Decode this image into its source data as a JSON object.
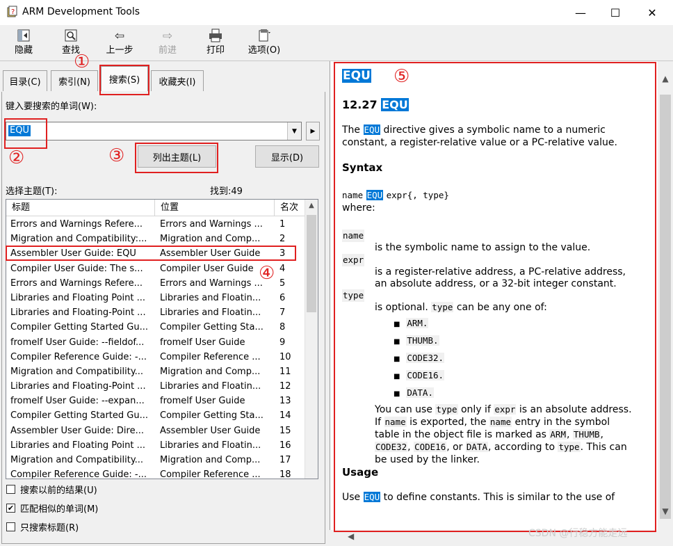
{
  "window": {
    "title": "ARM Development Tools",
    "minimize": "—",
    "maximize": "☐",
    "close": "✕"
  },
  "toolbar": {
    "hide": "隐藏",
    "find": "查找",
    "back": "上一步",
    "forward": "前进",
    "print": "打印",
    "options": "选项(O)"
  },
  "tabs": {
    "contents": "目录(C)",
    "index": "索引(N)",
    "search": "搜索(S)",
    "favorites": "收藏夹(I)"
  },
  "search": {
    "prompt": "键入要搜索的单词(W):",
    "value": "EQU",
    "list_topics": "列出主题(L)",
    "display": "显示(D)",
    "select_topic": "选择主题(T):",
    "found": "找到:49"
  },
  "table": {
    "headers": [
      "标题",
      "位置",
      "名次"
    ],
    "rows": [
      [
        "Errors and Warnings Refere...",
        "Errors and Warnings ...",
        "1"
      ],
      [
        "Migration and Compatibility:...",
        "Migration and Comp...",
        "2"
      ],
      [
        "Assembler User Guide: EQU",
        "Assembler User Guide",
        "3"
      ],
      [
        "Compiler User Guide: The s...",
        "Compiler User Guide",
        "4"
      ],
      [
        "Errors and Warnings Refere...",
        "Errors and Warnings ...",
        "5"
      ],
      [
        "Libraries and Floating Point ...",
        "Libraries and Floatin...",
        "6"
      ],
      [
        "Libraries and Floating-Point ...",
        "Libraries and Floatin...",
        "7"
      ],
      [
        "Compiler Getting Started Gu...",
        "Compiler Getting Sta...",
        "8"
      ],
      [
        "fromelf User Guide: --fieldof...",
        "fromelf User Guide",
        "9"
      ],
      [
        "Compiler Reference Guide: -...",
        "Compiler Reference ...",
        "10"
      ],
      [
        "Migration and Compatibility...",
        "Migration and Comp...",
        "11"
      ],
      [
        "Libraries and Floating-Point ...",
        "Libraries and Floatin...",
        "12"
      ],
      [
        "fromelf User Guide: --expan...",
        "fromelf User Guide",
        "13"
      ],
      [
        "Compiler Getting Started Gu...",
        "Compiler Getting Sta...",
        "14"
      ],
      [
        "Assembler User Guide: Dire...",
        "Assembler User Guide",
        "15"
      ],
      [
        "Libraries and Floating Point ...",
        "Libraries and Floatin...",
        "16"
      ],
      [
        "Migration and Compatibility...",
        "Migration and Comp...",
        "17"
      ],
      [
        "Compiler Reference Guide: -...",
        "Compiler Reference ...",
        "18"
      ]
    ]
  },
  "options": {
    "search_previous": "搜索以前的结果(U)",
    "match_similar": "匹配相似的单词(M)",
    "titles_only": "只搜索标题(R)",
    "match_similar_checked": true
  },
  "doc": {
    "heading": "EQU",
    "section_num": "12.27",
    "section_word": "EQU",
    "intro_pre": "The",
    "intro_code": "EQU",
    "intro_post1": "directive gives a symbolic name to a numeric",
    "intro_post2": "constant, a register-relative value or a PC-relative value.",
    "syntax_title": "Syntax",
    "syntax_name": "name",
    "syntax_equ": "EQU",
    "syntax_rest": "expr{, type}",
    "where": "where:",
    "term_name": "name",
    "def_name": "is the symbolic name to assign to the value.",
    "term_expr": "expr",
    "def_expr1": "is a register-relative address, a PC-relative address,",
    "def_expr2": "an absolute address, or a 32-bit integer constant.",
    "term_type": "type",
    "def_type_pre": "is optional.",
    "def_type_code": "type",
    "def_type_post": "can be any one of:",
    "bullets": [
      "ARM.",
      "THUMB.",
      "CODE32.",
      "CODE16.",
      "DATA."
    ],
    "p1_a": "You can use",
    "p1_b": "type",
    "p1_c": "only if",
    "p1_d": "expr",
    "p1_e": "is an absolute address.",
    "p2_a": "If",
    "p2_b": "name",
    "p2_c": "is exported, the",
    "p2_d": "name",
    "p2_e": "entry in the symbol",
    "p3": "table in the object file is marked as",
    "p3_arm": "ARM",
    "p3_comma": ",",
    "p3_thumb": "THUMB",
    "p3_end": ",",
    "p4_code32": "CODE32",
    "p4_c1": ",",
    "p4_code16": "CODE16",
    "p4_or": ", or",
    "p4_data": "DATA",
    "p4_acc": ", according to",
    "p4_type": "type",
    "p4_end": ". This can",
    "p5": "be used by the linker.",
    "usage_title": "Usage",
    "usage_pre": "Use",
    "usage_code": "EQU",
    "usage_post": "to define constants. This is similar to the use of"
  },
  "annotations": {
    "n1": "①",
    "n2": "②",
    "n3": "③",
    "n4": "④",
    "n5": "⑤"
  },
  "watermark": "CSDN @行稳方能走远"
}
